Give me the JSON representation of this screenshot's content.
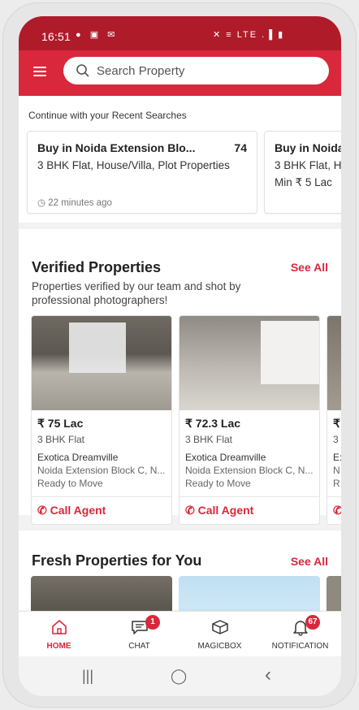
{
  "status_bar": {
    "time": "16:51",
    "left_icons": "● ▣ ✉",
    "right_icons": "✕ ≡ LTE .▐ ▮"
  },
  "header": {
    "search_placeholder": "Search Property"
  },
  "recent_searches": {
    "title": "Continue with your Recent Searches",
    "items": [
      {
        "name": "Buy in Noida Extension Blo...",
        "count": "74",
        "type": "3 BHK Flat, House/Villa, Plot Properties",
        "time": "22 minutes ago"
      },
      {
        "name": "Buy in Noida",
        "type": "3 BHK Flat, H",
        "min": "Min ₹ 5 Lac"
      }
    ]
  },
  "verified": {
    "title": "Verified Properties",
    "see_all": "See All",
    "subtitle": "Properties verified by our team and shot by professional photographers!",
    "cards": [
      {
        "price": "₹ 75 Lac",
        "type": "3 BHK Flat",
        "project": "Exotica Dreamville",
        "location": "Noida Extension Block C, N...",
        "status": "Ready to Move",
        "call": "Call Agent"
      },
      {
        "price": "₹ 72.3 Lac",
        "type": "3 BHK Flat",
        "project": "Exotica Dreamville",
        "location": "Noida Extension Block C, N...",
        "status": "Ready to Move",
        "call": "Call Agent"
      },
      {
        "price": "₹",
        "type": "3",
        "project": "E:",
        "location": "N",
        "status": "R",
        "call": ""
      }
    ]
  },
  "fresh": {
    "title": "Fresh Properties for You",
    "see_all": "See All"
  },
  "bottom_nav": [
    {
      "label": "HOME",
      "icon": "home-icon",
      "active": true
    },
    {
      "label": "CHAT",
      "icon": "chat-icon",
      "badge": "1"
    },
    {
      "label": "MAGICBOX",
      "icon": "magicbox-icon"
    },
    {
      "label": "NOTIFICATION",
      "icon": "bell-icon",
      "badge": "67"
    }
  ],
  "system_nav": {
    "recents": "|||",
    "home": "◯",
    "back": "‹"
  },
  "colors": {
    "brand": "#d9283b",
    "status_bar": "#b01b2a"
  }
}
